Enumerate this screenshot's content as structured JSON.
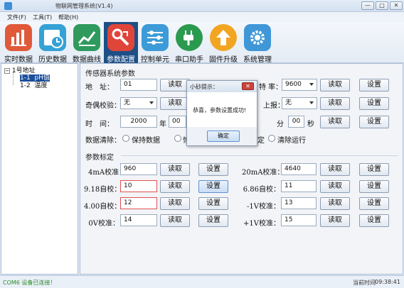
{
  "window": {
    "title": "物联网管理系统(V1.4)",
    "controls": [
      "—",
      "□",
      "✕"
    ]
  },
  "menu": [
    "文件(F)",
    "工具(T)",
    "帮助(H)"
  ],
  "toolbar": [
    {
      "label": "实时数据",
      "icon": "realtime-chart-icon",
      "color": "#e05a3a"
    },
    {
      "label": "历史数据",
      "icon": "history-clock-icon",
      "color": "#35a2d6"
    },
    {
      "label": "数据曲线",
      "icon": "trend-curve-icon",
      "color": "#2f9a5d"
    },
    {
      "label": "参数配置",
      "icon": "wrench-config-icon",
      "color": "#e0453a",
      "active": true
    },
    {
      "label": "控制单元",
      "icon": "sliders-icon",
      "color": "#3d9bd8"
    },
    {
      "label": "串口助手",
      "icon": "plug-icon",
      "color": "#2a9a4e"
    },
    {
      "label": "固件升级",
      "icon": "upgrade-arrow-icon",
      "color": "#f2a520"
    },
    {
      "label": "系统管理",
      "icon": "gear-icon",
      "color": "#3f97d8"
    }
  ],
  "tree": {
    "root": "1号地址",
    "children": [
      {
        "id": "1-1",
        "name": "pH值",
        "selected": true
      },
      {
        "id": "1-2",
        "name": "温度",
        "selected": false
      }
    ]
  },
  "sensor_section": {
    "title": "传感器系统参数",
    "address_label": "地　址：",
    "address_value": "01",
    "baud_label_visible": "特 率：",
    "baud_value": "9600",
    "parity_label": "奇偶校验：",
    "parity_value": "无",
    "upload_label_visible": "上报：",
    "upload_value": "无",
    "time_label": "时　间：",
    "year_value": "2000",
    "year_unit": "年",
    "month_value": "00",
    "minute_unit": "分",
    "second_value": "00",
    "second_unit": "秒",
    "clear_label": "数据清除：",
    "keep_data": "保持数据",
    "partial_hidden": "恢",
    "partial_hidden2": "定",
    "clear_run": "清除运行"
  },
  "calib_section": {
    "title": "参数标定",
    "rows": [
      {
        "left_label": "4mA校准：",
        "left_value": "960",
        "right_label": "20mA校准：",
        "right_value": "4640"
      },
      {
        "left_label": "9.18自校：",
        "left_value": "10",
        "left_err": true,
        "right_label": "6.86自校：",
        "right_value": "11"
      },
      {
        "left_label": "4.00自校：",
        "left_value": "12",
        "left_err": true,
        "right_label": "-1V校准：",
        "right_value": "13"
      },
      {
        "left_label": "0V校准：",
        "left_value": "14",
        "right_label": "+1V校准：",
        "right_value": "15"
      }
    ]
  },
  "buttons": {
    "read": "读取",
    "set": "设置"
  },
  "dialog": {
    "title": "小砂提示：",
    "message": "恭喜，参数设置成功!",
    "ok": "确定",
    "close": "✕"
  },
  "status": {
    "connection": "COM6 设备已连接！",
    "time_label": "当前时间",
    "time_value": "09:38:41"
  },
  "colors": {
    "accent": "#1e4e86",
    "success_text": "#2b8a2b",
    "error_border": "#e05050"
  }
}
